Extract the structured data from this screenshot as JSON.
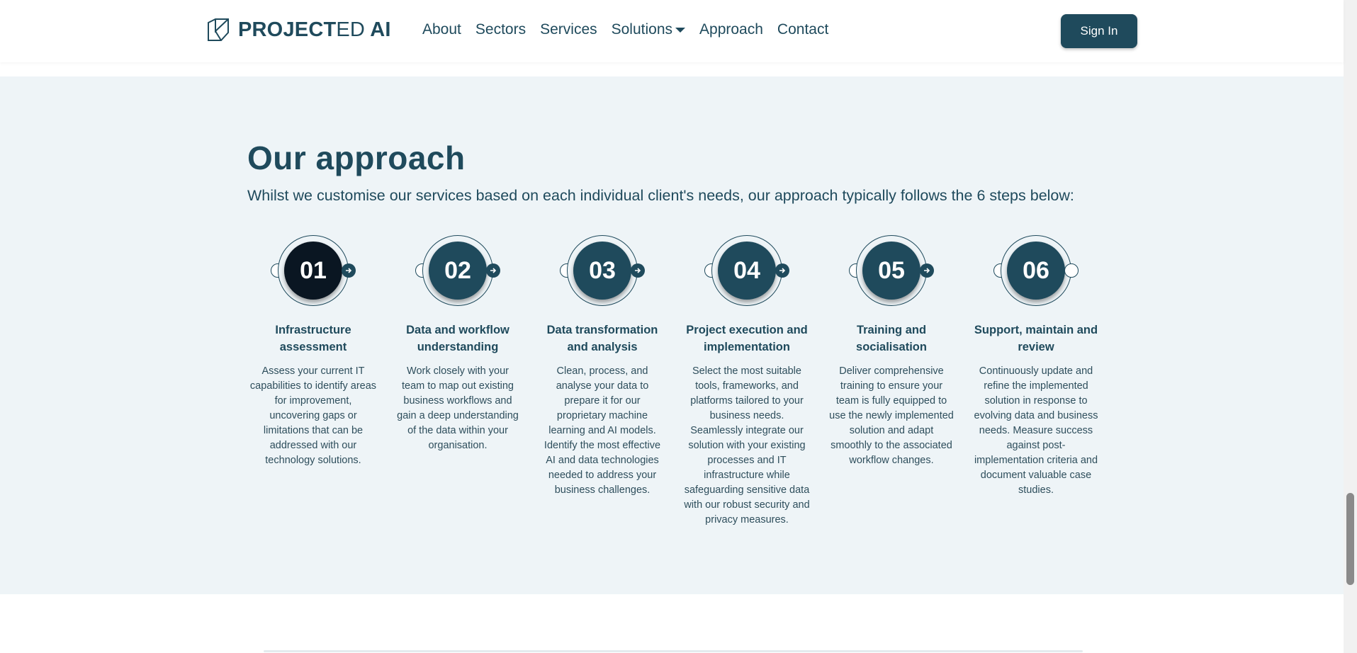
{
  "header": {
    "logo_bold": "PROJECT",
    "logo_light": "ED",
    "logo_ai": " AI",
    "nav": {
      "about": "About",
      "sectors": "Sectors",
      "services": "Services",
      "solutions": "Solutions",
      "approach": "Approach",
      "contact": "Contact"
    },
    "sign_in": "Sign In"
  },
  "section": {
    "title": "Our approach",
    "subtitle": "Whilst we customise our services based on each individual client's needs, our approach typically follows the 6 steps below:"
  },
  "steps": [
    {
      "number": "01",
      "title": "Infrastructure assessment",
      "desc": "Assess your current IT capabilities to identify areas for improvement, uncovering gaps or limitations that can be addressed with our technology solutions."
    },
    {
      "number": "02",
      "title": "Data and workflow understanding",
      "desc": "Work closely with your team to map out existing business workflows and gain a deep understanding of the data within your organisation."
    },
    {
      "number": "03",
      "title": "Data transformation and analysis",
      "desc": "Clean, process, and analyse your data to prepare it for our proprietary machine learning and AI models. Identify the most effective AI and data technologies needed to address your business challenges."
    },
    {
      "number": "04",
      "title": "Project execution and implementation",
      "desc": "Select the most suitable tools, frameworks, and platforms tailored to your business needs. Seamlessly integrate our solution with your existing processes and IT infrastructure while safeguarding sensitive data with our robust security and privacy measures."
    },
    {
      "number": "05",
      "title": "Training and socialisation",
      "desc": "Deliver comprehensive training to ensure your team is fully equipped to use the newly implemented solution and adapt smoothly to the associated workflow changes."
    },
    {
      "number": "06",
      "title": "Support, maintain and review",
      "desc": "Continuously update and refine the implemented solution in response to evolving data and business needs. Measure success against post-implementation criteria and document valuable case studies."
    }
  ],
  "colors": {
    "accent": "#1f4a5c",
    "active_step": "#0a1622",
    "section_bg": "#eef4f7"
  }
}
